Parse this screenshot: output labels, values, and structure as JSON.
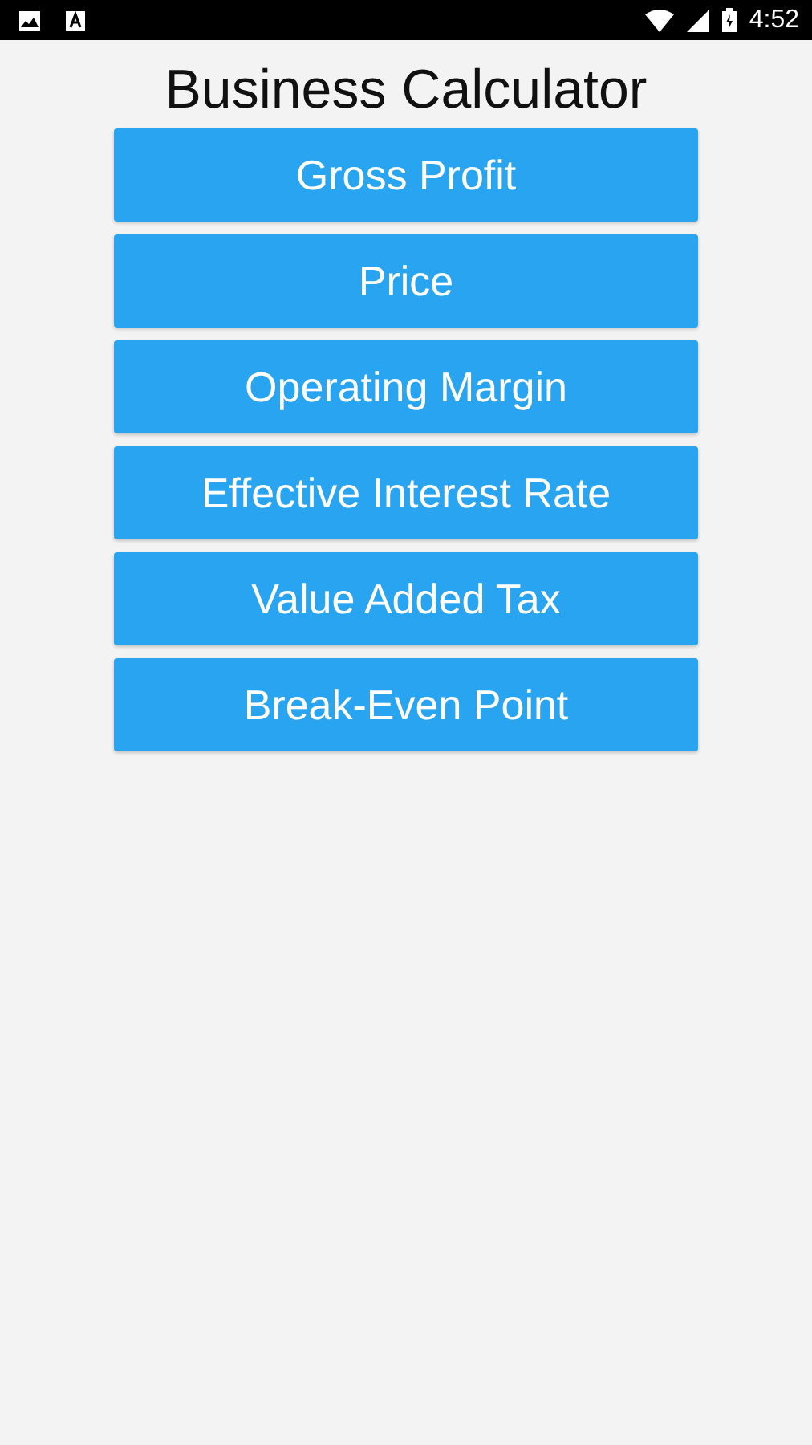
{
  "status_bar": {
    "time": "4:52"
  },
  "title": "Business Calculator",
  "buttons": [
    "Gross Profit",
    "Price",
    "Operating Margin",
    "Effective Interest Rate",
    "Value Added Tax",
    "Break-Even Point"
  ]
}
